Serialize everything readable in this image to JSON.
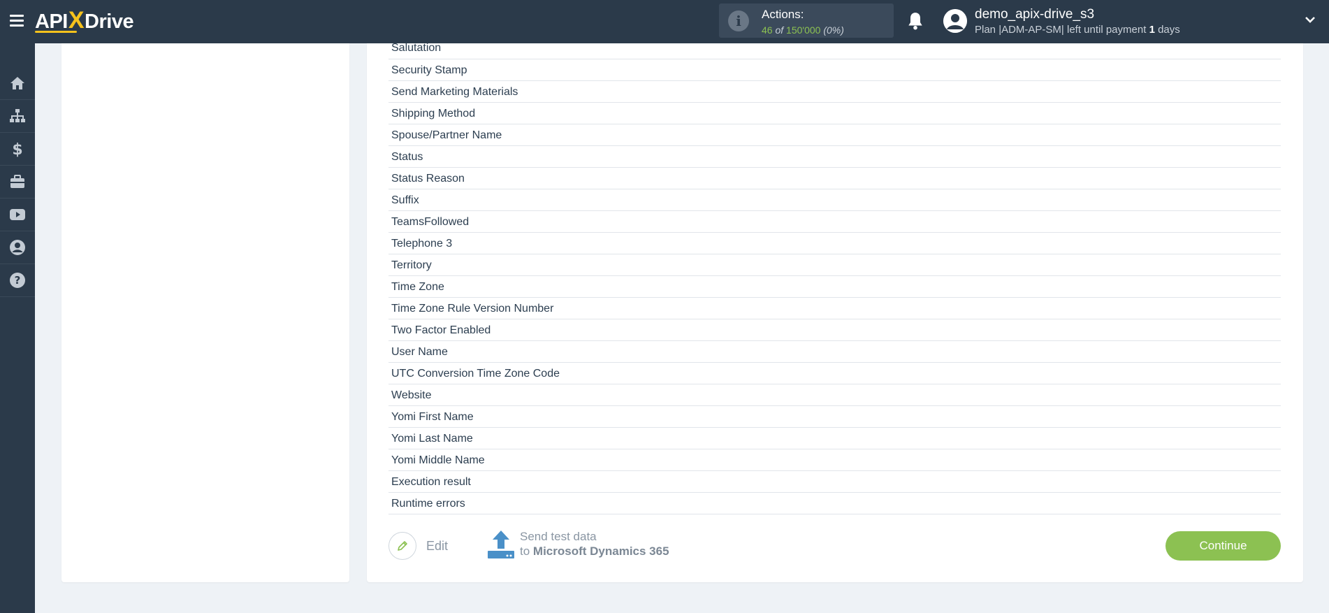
{
  "topbar": {
    "logo_left": "API",
    "logo_x": "X",
    "logo_right": "Drive",
    "actions_title": "Actions:",
    "actions_used": "46",
    "actions_of": "of",
    "actions_total": "150'000",
    "actions_percent": "(0%)",
    "user_name": "demo_apix-drive_s3",
    "plan_text": "Plan |ADM-AP-SM| left until payment",
    "plan_days": "1",
    "plan_days_unit": "days"
  },
  "sidebar": {
    "items": [
      {
        "icon": "home-icon"
      },
      {
        "icon": "sitemap-icon"
      },
      {
        "icon": "dollar-icon"
      },
      {
        "icon": "briefcase-icon"
      },
      {
        "icon": "youtube-icon"
      },
      {
        "icon": "user-circle-icon"
      },
      {
        "icon": "question-circle-icon"
      }
    ]
  },
  "fields": [
    "Salutation",
    "Security Stamp",
    "Send Marketing Materials",
    "Shipping Method",
    "Spouse/Partner Name",
    "Status",
    "Status Reason",
    "Suffix",
    "TeamsFollowed",
    "Telephone 3",
    "Territory",
    "Time Zone",
    "Time Zone Rule Version Number",
    "Two Factor Enabled",
    "User Name",
    "UTC Conversion Time Zone Code",
    "Website",
    "Yomi First Name",
    "Yomi Last Name",
    "Yomi Middle Name",
    "Execution result",
    "Runtime errors"
  ],
  "footer": {
    "edit_label": "Edit",
    "send_line1": "Send test data",
    "send_to": "to",
    "send_target": "Microsoft Dynamics 365",
    "continue_label": "Continue"
  },
  "colors": {
    "topbar_bg": "#2b3a4a",
    "accent_green": "#8cc152",
    "logo_yellow": "#f6c21c",
    "icon_blue": "#4a90c8"
  }
}
